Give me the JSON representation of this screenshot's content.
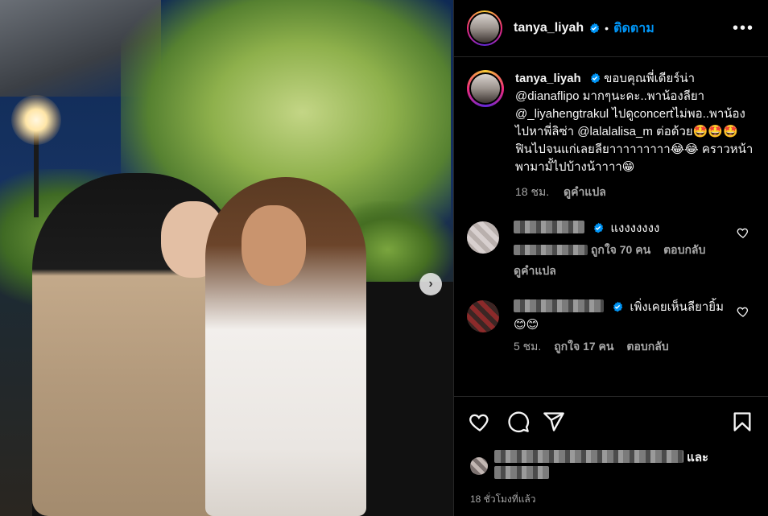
{
  "post": {
    "username": "tanya_liyah",
    "follow_label": "ติดตาม",
    "more_label": "•••",
    "next_label": "›"
  },
  "caption": {
    "username": "tanya_liyah",
    "text_1": "ขอบคุณพี่เดียร์น่า",
    "text_2": "@dianaflipo มากๆนะคะ..พาน้องลียา @_liyahengtrakul ไปดูconcertไม่พอ..พาน้องไปหาพี่ลิซ่า @lalalalisa_m ต่อด้วย🤩🤩🤩 ฟินไปจนแก่เลยลียาาาาาาาาา😂😂 คราวหน้าพามามั้ไปบ้างน้าาาา😁",
    "time": "18 ชม.",
    "translate": "ดูคำแปล"
  },
  "comments": [
    {
      "text": "แงงงงงงง",
      "likes": "ถูกใจ 70 คน",
      "reply": "ตอบกลับ",
      "translate": "ดูคำแปล"
    },
    {
      "text": "เพิ่งเคยเห็นลียายิ้ม 😊😊",
      "time": "5 ชม.",
      "likes": "ถูกใจ 17 คน",
      "reply": "ตอบกลับ"
    }
  ],
  "footer": {
    "likes_suffix": "และ",
    "time": "18 ชั่วโมงที่แล้ว"
  },
  "colors": {
    "background": "#000000",
    "accent": "#0095f6",
    "muted": "#a8a8a8",
    "text": "#f5f5f5"
  },
  "icons": {
    "like": "heart-icon",
    "comment": "comment-icon",
    "share": "share-icon",
    "save": "bookmark-icon",
    "verified": "verified-badge-icon",
    "more": "more-options-icon",
    "next": "chevron-right-icon"
  }
}
